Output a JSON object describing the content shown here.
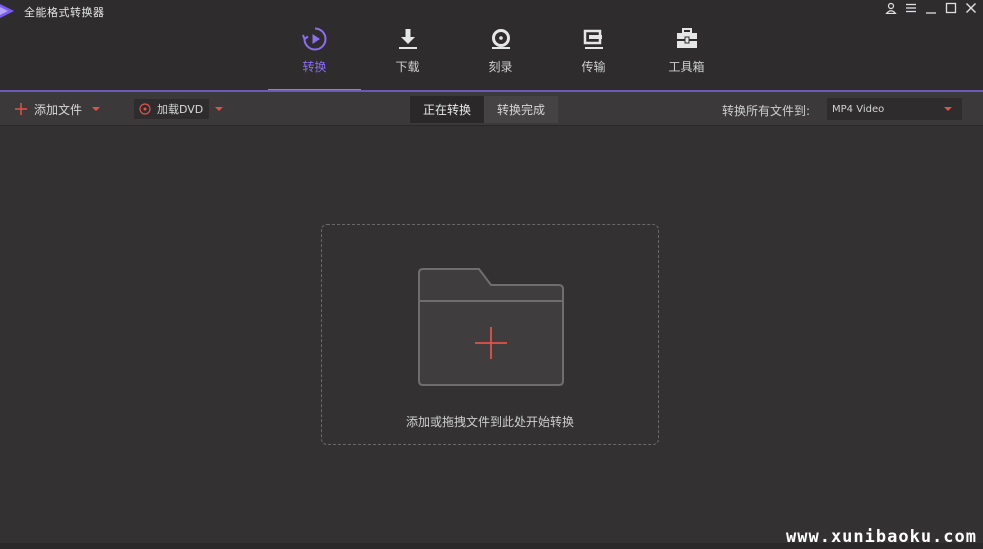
{
  "window": {
    "title": "全能格式转换器"
  },
  "nav": {
    "items": [
      {
        "label": "转换",
        "icon": "convert-icon",
        "active": true
      },
      {
        "label": "下载",
        "icon": "download-icon",
        "active": false
      },
      {
        "label": "刻录",
        "icon": "burn-icon",
        "active": false
      },
      {
        "label": "传输",
        "icon": "transfer-icon",
        "active": false
      },
      {
        "label": "工具箱",
        "icon": "toolbox-icon",
        "active": false
      }
    ]
  },
  "toolbar": {
    "add_file": "添加文件",
    "load_dvd": "加载DVD",
    "tab_converting": "正在转换",
    "tab_finished": "转换完成",
    "convert_all_label": "转换所有文件到:",
    "format_value": "MP4 Video"
  },
  "dropzone": {
    "hint": "添加或拖拽文件到此处开始转换"
  },
  "watermark": "www.xunibaoku.com",
  "colors": {
    "accent": "#8c6ef0",
    "plus": "#e0524a",
    "background": "#333131"
  }
}
